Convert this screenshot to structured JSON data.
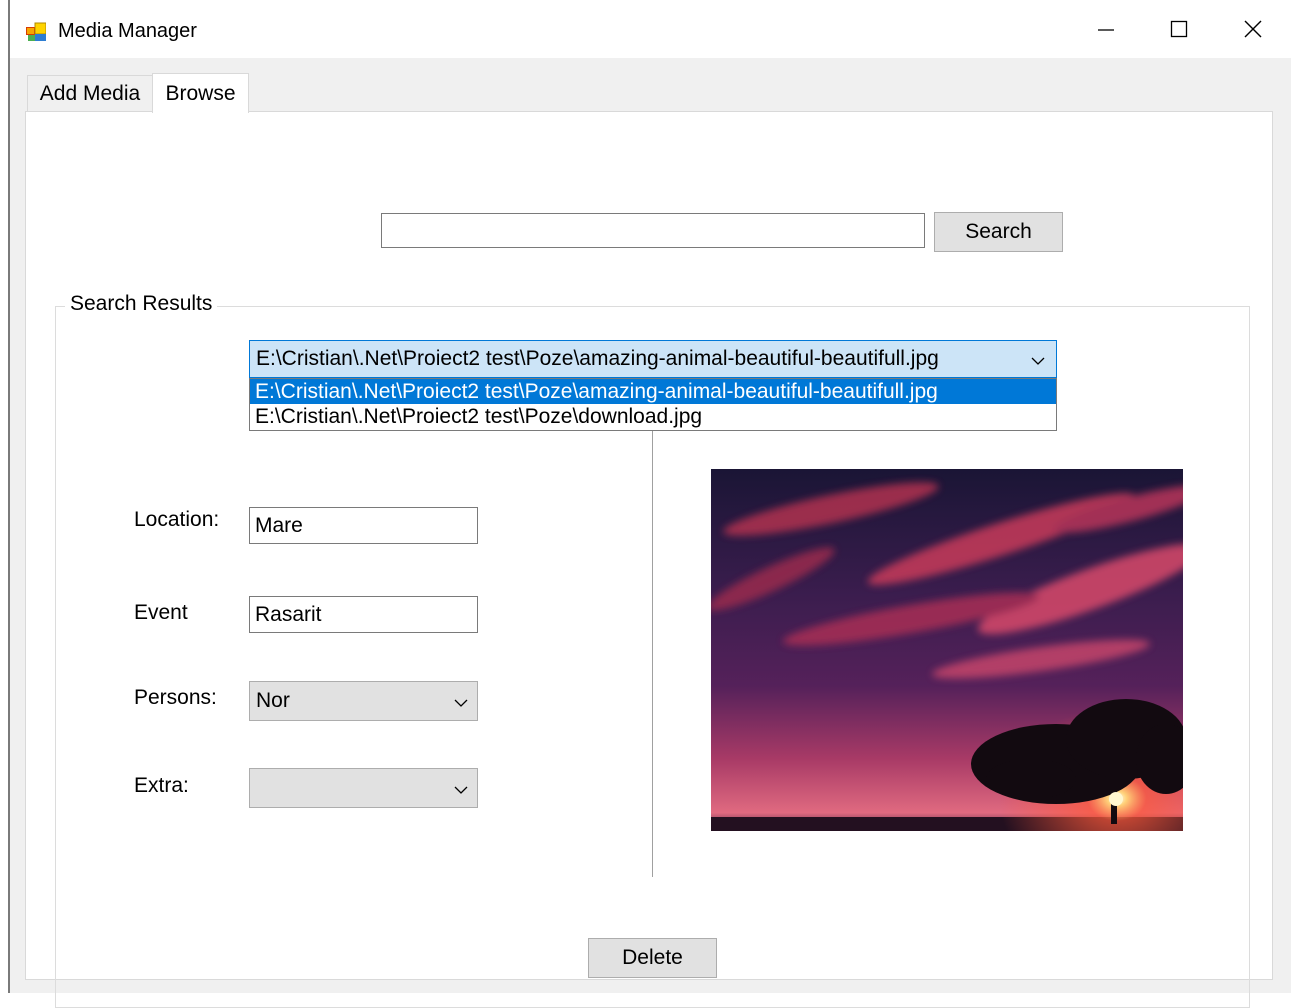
{
  "window": {
    "title": "Media Manager",
    "controls": [
      "minimize-icon",
      "maximize-icon",
      "close-icon"
    ]
  },
  "tabs": [
    {
      "label": "Add Media",
      "selected": false
    },
    {
      "label": "Browse",
      "selected": true
    }
  ],
  "search": {
    "value": "",
    "button_label": "Search"
  },
  "results": {
    "group_label": "Search Results",
    "selected_file": "E:\\Cristian\\.Net\\Proiect2 test\\Poze\\amazing-animal-beautiful-beautifull.jpg",
    "dropdown_items": [
      "E:\\Cristian\\.Net\\Proiect2 test\\Poze\\amazing-animal-beautiful-beautifull.jpg",
      "E:\\Cristian\\.Net\\Proiect2 test\\Poze\\download.jpg"
    ]
  },
  "fields": {
    "location": {
      "label": "Location:",
      "value": "Mare"
    },
    "event": {
      "label": "Event",
      "value": "Rasarit"
    },
    "persons": {
      "label": "Persons:",
      "value": "Nor"
    },
    "extra": {
      "label": "Extra:",
      "value": ""
    }
  },
  "delete_label": "Delete",
  "colors": {
    "accent": "#0078d7",
    "combo_highlight": "#cce4f7",
    "button_face": "#e1e1e1",
    "window_bg": "#f0f0f0"
  }
}
